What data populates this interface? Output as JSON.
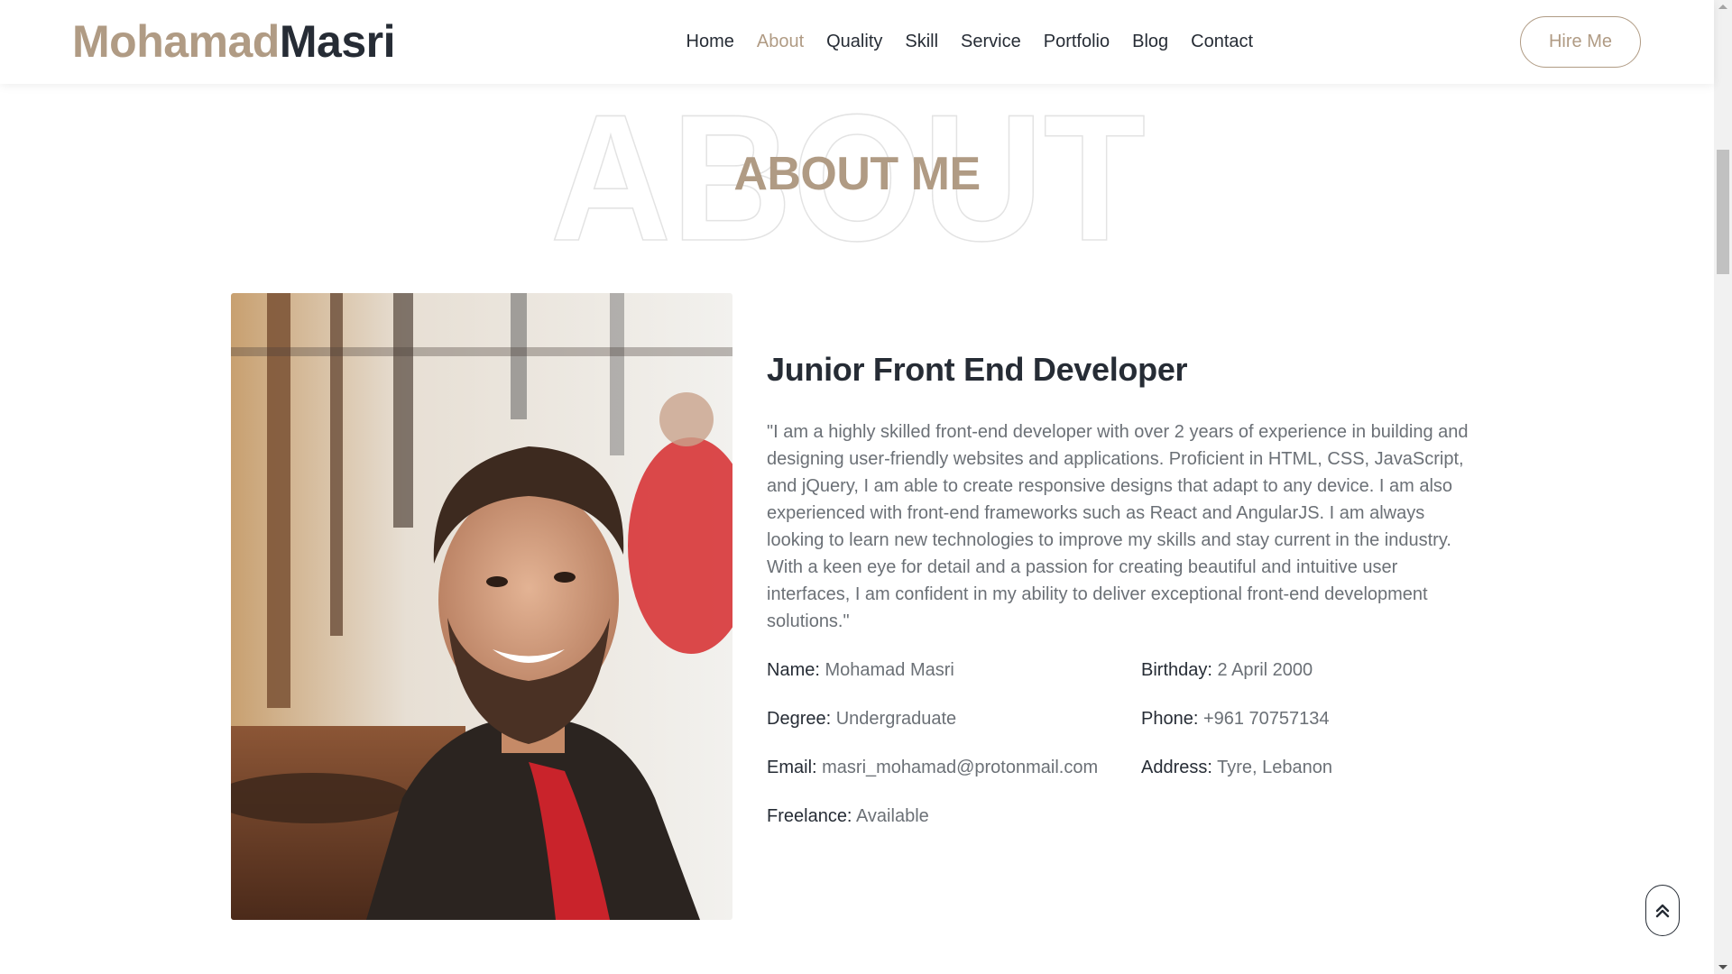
{
  "brand": {
    "first": "Mohamad",
    "last": "Masri"
  },
  "nav": {
    "items": [
      {
        "label": "Home",
        "active": false
      },
      {
        "label": "About",
        "active": true
      },
      {
        "label": "Quality",
        "active": false
      },
      {
        "label": "Skill",
        "active": false
      },
      {
        "label": "Service",
        "active": false
      },
      {
        "label": "Portfolio",
        "active": false
      },
      {
        "label": "Blog",
        "active": false
      },
      {
        "label": "Contact",
        "active": false
      }
    ],
    "cta_label": "Hire Me"
  },
  "about": {
    "background_word": "ABOUT",
    "title": "ABOUT ME",
    "role": "Junior Front End Developer",
    "bio": "\"I am a highly skilled front-end developer with over 2 years of experience in building and designing user-friendly websites and applications. Proficient in HTML, CSS, JavaScript, and jQuery, I am able to create responsive designs that adapt to any device. I am also experienced with front-end frameworks such as React and AngularJS. I am always looking to learn new technologies to improve my skills and stay current in the industry. With a keen eye for detail and a passion for creating beautiful and intuitive user interfaces, I am confident in my ability to deliver exceptional front-end development solutions.\"",
    "details": [
      {
        "label": "Name:",
        "value": "Mohamad Masri"
      },
      {
        "label": "Birthday:",
        "value": "2 April 2000"
      },
      {
        "label": "Degree:",
        "value": "Undergraduate"
      },
      {
        "label": "Phone:",
        "value": "+961 70757134"
      },
      {
        "label": "Email:",
        "value": "masri_mohamad@protonmail.com"
      },
      {
        "label": "Address:",
        "value": "Tyre, Lebanon"
      },
      {
        "label": "Freelance:",
        "value": "Available"
      }
    ]
  },
  "colors": {
    "accent": "#b09b84",
    "dark": "#262c35",
    "muted": "#6b7076"
  },
  "icons": {
    "scroll_top": "double-chevron-up-icon"
  }
}
